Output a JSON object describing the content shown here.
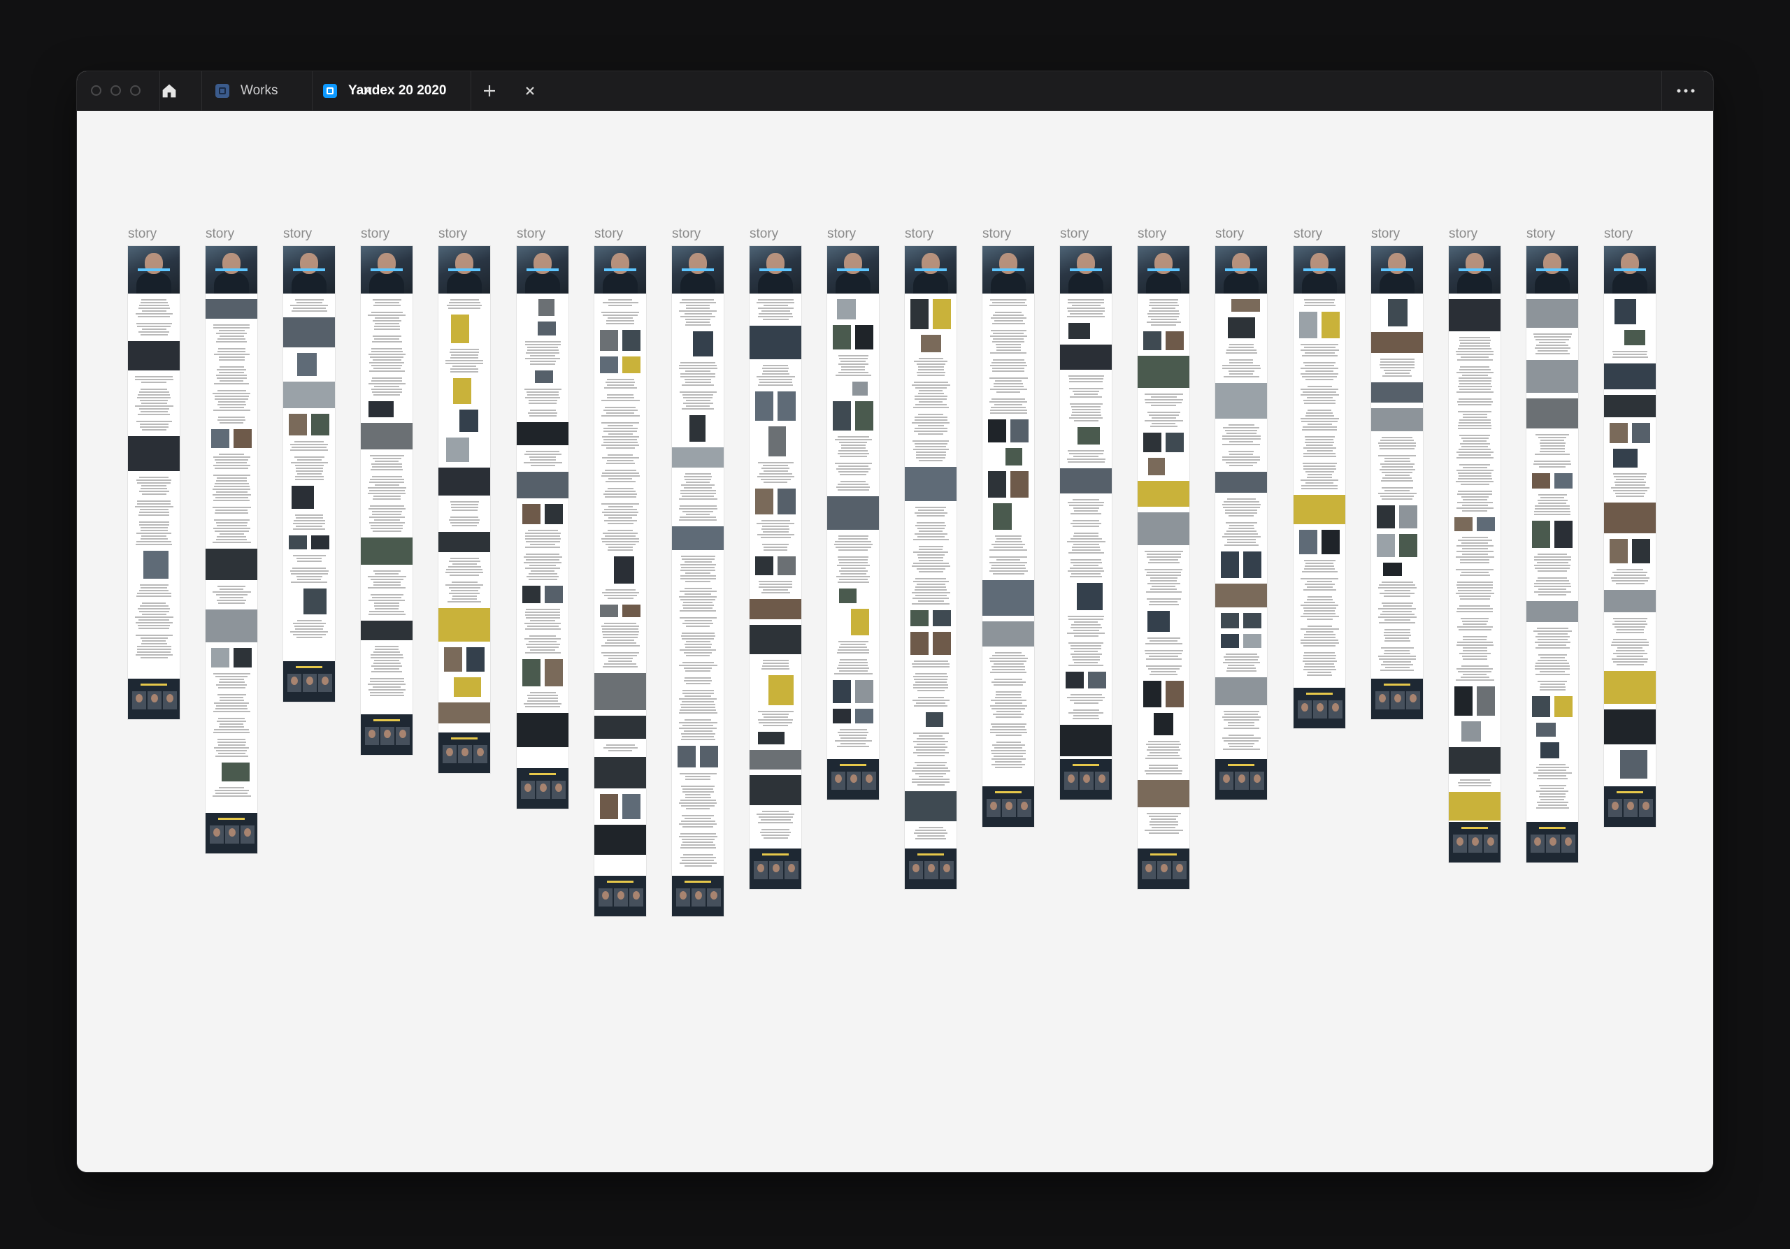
{
  "window": {
    "tabs": [
      {
        "label": "Works",
        "active": false,
        "icon": "figma-file-icon"
      },
      {
        "label": "Yandex 20 2020",
        "active": true,
        "icon": "figma-file-icon"
      }
    ],
    "home_icon": "home-icon",
    "new_tab_icon": "plus-icon",
    "menu_icon": "more-horizontal-icon"
  },
  "canvas": {
    "background": "#f4f4f4",
    "frames": [
      {
        "label": "story",
        "length": 0.53
      },
      {
        "label": "story",
        "length": 0.68
      },
      {
        "label": "story",
        "length": 0.51
      },
      {
        "label": "story",
        "length": 0.57
      },
      {
        "label": "story",
        "length": 0.59
      },
      {
        "label": "story",
        "length": 0.63
      },
      {
        "label": "story",
        "length": 0.75
      },
      {
        "label": "story",
        "length": 0.75
      },
      {
        "label": "story",
        "length": 0.72
      },
      {
        "label": "story",
        "length": 0.62
      },
      {
        "label": "story",
        "length": 0.72
      },
      {
        "label": "story",
        "length": 0.65
      },
      {
        "label": "story",
        "length": 0.62
      },
      {
        "label": "story",
        "length": 0.72
      },
      {
        "label": "story",
        "length": 0.62
      },
      {
        "label": "story",
        "length": 0.54
      },
      {
        "label": "story",
        "length": 0.53
      },
      {
        "label": "story",
        "length": 0.69
      },
      {
        "label": "story",
        "length": 0.69
      },
      {
        "label": "story",
        "length": 0.65
      }
    ]
  },
  "colors": {
    "app_background": "#111112",
    "titlebar": "#1c1c1e",
    "accent_tab_icon": "#0d99ff",
    "inactive_tab_icon": "#3b5b8c",
    "footer_block": "#1e2833"
  }
}
